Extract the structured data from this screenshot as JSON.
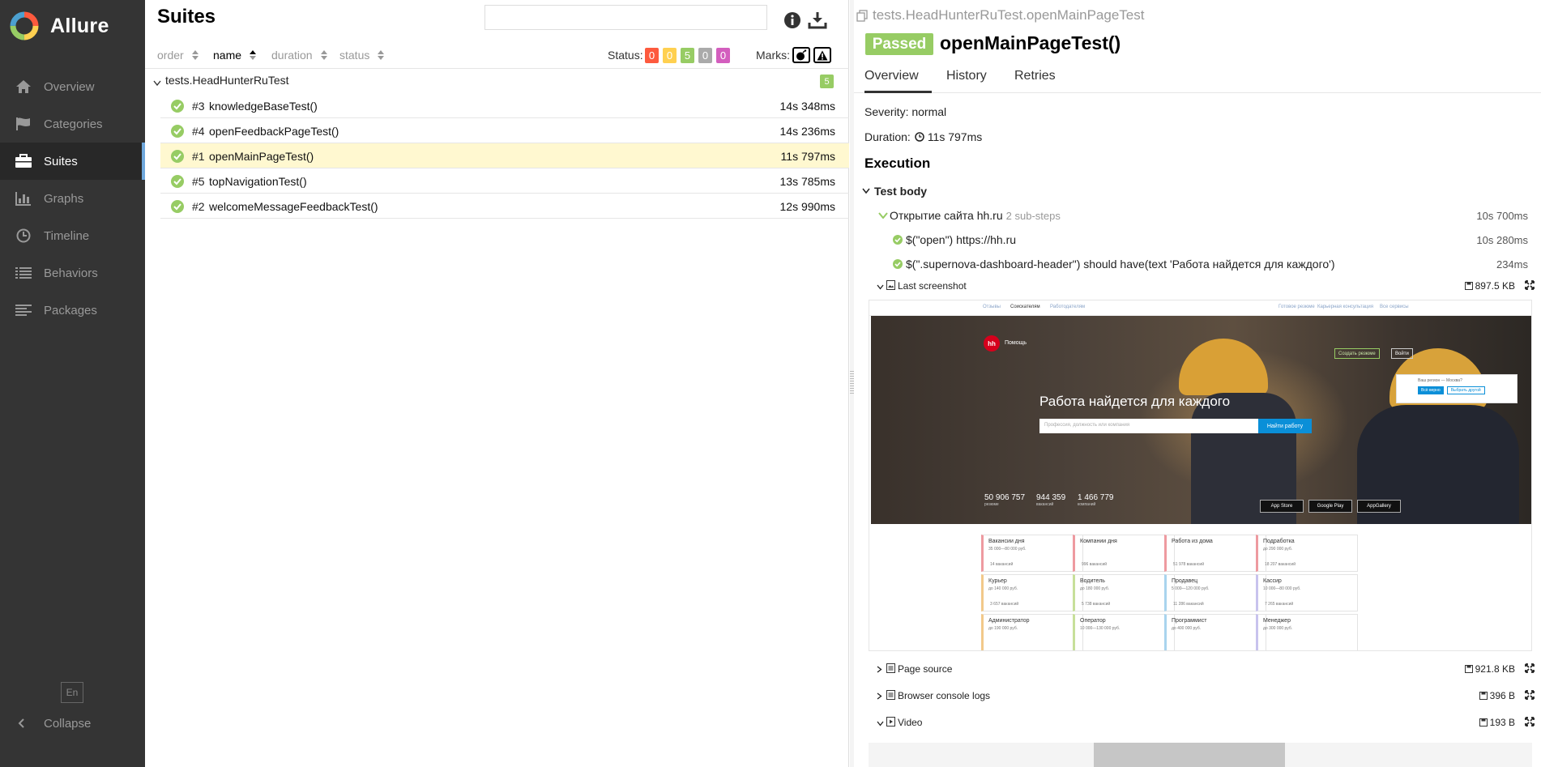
{
  "app": {
    "name": "Allure"
  },
  "sidebar": {
    "items": [
      {
        "label": "Overview",
        "icon": "home-icon"
      },
      {
        "label": "Categories",
        "icon": "flag-icon"
      },
      {
        "label": "Suites",
        "icon": "briefcase-icon",
        "active": true
      },
      {
        "label": "Graphs",
        "icon": "bar-chart-icon"
      },
      {
        "label": "Timeline",
        "icon": "clock-icon"
      },
      {
        "label": "Behaviors",
        "icon": "list-icon"
      },
      {
        "label": "Packages",
        "icon": "align-left-icon"
      }
    ],
    "lang": "En",
    "collapse": "Collapse"
  },
  "suites": {
    "title": "Suites",
    "search_value": "",
    "sort": [
      "order",
      "name",
      "duration",
      "status"
    ],
    "status_label": "Status:",
    "status_counts": [
      {
        "value": "0",
        "color": "#fd5a3e"
      },
      {
        "value": "0",
        "color": "#ffd050"
      },
      {
        "value": "5",
        "color": "#97cc64"
      },
      {
        "value": "0",
        "color": "#aaaaaa"
      },
      {
        "value": "0",
        "color": "#d35ebe"
      }
    ],
    "marks_label": "Marks:",
    "group": {
      "title": "tests.HeadHunterRuTest",
      "count": "5"
    },
    "rows": [
      {
        "num": "#3",
        "name": "knowledgeBaseTest()",
        "duration": "14s 348ms"
      },
      {
        "num": "#4",
        "name": "openFeedbackPageTest()",
        "duration": "14s 236ms"
      },
      {
        "num": "#1",
        "name": "openMainPageTest()",
        "duration": "11s 797ms",
        "selected": true
      },
      {
        "num": "#5",
        "name": "topNavigationTest()",
        "duration": "13s 785ms"
      },
      {
        "num": "#2",
        "name": "welcomeMessageFeedbackTest()",
        "duration": "12s 990ms"
      }
    ]
  },
  "detail": {
    "breadcrumb": "tests.HeadHunterRuTest.openMainPageTest",
    "status": "Passed",
    "status_color": "#97cc64",
    "name": "openMainPageTest()",
    "tabs": [
      "Overview",
      "History",
      "Retries"
    ],
    "severity": "Severity: normal",
    "duration_label": "Duration:",
    "duration": "11s 797ms",
    "execution": "Execution",
    "test_body": "Test body",
    "step": {
      "title": "Открытие сайта hh.ru",
      "sub": "2 sub-steps",
      "duration": "10s 700ms"
    },
    "substeps": [
      {
        "title": "$(\"open\") https://hh.ru",
        "duration": "10s 280ms"
      },
      {
        "title": "$(\".supernova-dashboard-header\") should have(text 'Работа найдется для каждого')",
        "duration": "234ms"
      }
    ],
    "attachments": [
      {
        "name": "Last screenshot",
        "size": "897.5 KB"
      },
      {
        "name": "Page source",
        "size": "921.8 KB"
      },
      {
        "name": "Browser console logs",
        "size": "396 B"
      },
      {
        "name": "Video",
        "size": "193 B"
      }
    ]
  },
  "screenshot": {
    "top_links": [
      "Отзывы",
      "Соискателям",
      "Работодателям",
      "Готовое резюме",
      "Карьерная консультация",
      "Все сервисы"
    ],
    "logo": "hh",
    "help": "Помощь",
    "title": "Работа найдется для каждого",
    "search_placeholder": "Профессия, должность или компания",
    "search_button": "Найти работу",
    "create_resume": "Создать резюме",
    "login": "Войти",
    "region_text": "Ваш регион — Москва?",
    "region_yes": "Всё верно",
    "region_other": "Выбрать другой",
    "stats": [
      {
        "value": "50 906 757",
        "label": "резюме"
      },
      {
        "value": "944 359",
        "label": "вакансий"
      },
      {
        "value": "1 466 779",
        "label": "компаний"
      }
    ],
    "stores": [
      "App Store",
      "Google Play",
      "AppGallery"
    ],
    "cards": [
      {
        "title": "Вакансии дня",
        "salary": "35 000—80 000 руб.",
        "count": "14 вакансий",
        "color": "#ee9aa0"
      },
      {
        "title": "Компании дня",
        "salary": "",
        "count": "996 вакансий",
        "color": "#ee9aa0"
      },
      {
        "title": "Работа из дома",
        "salary": "",
        "count": "51 978 вакансий",
        "color": "#ee9aa0"
      },
      {
        "title": "Подработка",
        "salary": "до 290 000 руб.",
        "count": "18 207 вакансий",
        "color": "#ee9aa0"
      },
      {
        "title": "Курьер",
        "salary": "до 140 000 руб.",
        "count": "3 657 вакансий",
        "color": "#f2c98a"
      },
      {
        "title": "Водитель",
        "salary": "до 180 000 руб.",
        "count": "5 738 вакансий",
        "color": "#c7e09a"
      },
      {
        "title": "Продавец",
        "salary": "5 000—120 000 руб.",
        "count": "11 286 вакансий",
        "color": "#a9d4ee"
      },
      {
        "title": "Кассир",
        "salary": "10 000—80 000 руб.",
        "count": "7 265 вакансий",
        "color": "#c8c3ee"
      },
      {
        "title": "Администратор",
        "salary": "до 190 000 руб.",
        "count": "",
        "color": "#f2c98a"
      },
      {
        "title": "Оператор",
        "salary": "10 000—130 000 руб.",
        "count": "",
        "color": "#c7e09a"
      },
      {
        "title": "Программист",
        "salary": "до 400 000 руб.",
        "count": "",
        "color": "#a9d4ee"
      },
      {
        "title": "Менеджер",
        "salary": "до 300 000 руб.",
        "count": "",
        "color": "#c8c3ee"
      }
    ]
  }
}
